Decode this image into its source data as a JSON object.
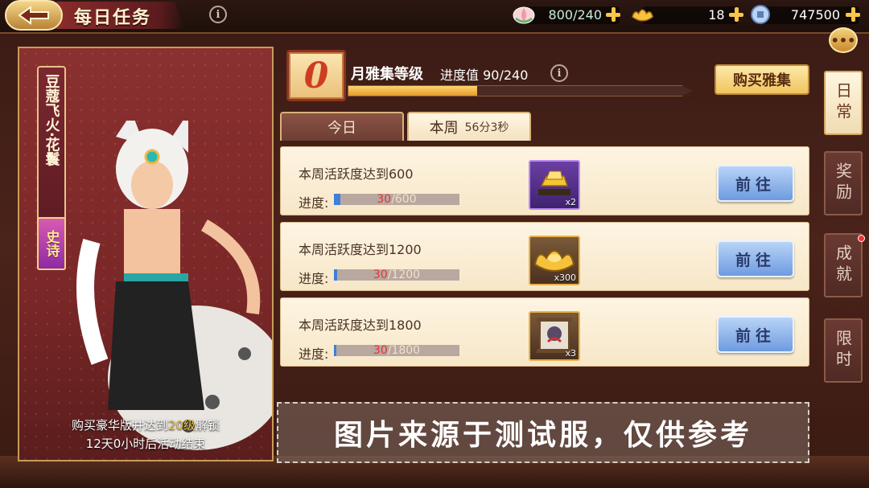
{
  "header": {
    "title": "每日任务",
    "info_icon": "i",
    "resources": [
      {
        "icon": "lotus-flower-icon",
        "value": "800/240"
      },
      {
        "icon": "gold-ingot-icon",
        "value": "18"
      },
      {
        "icon": "silver-coin-icon",
        "value": "747500"
      }
    ]
  },
  "left_panel": {
    "character_name": "豆蔻飞火·花鬟",
    "rarity": "史诗",
    "unlock_prefix": "购买豪华版并达到",
    "unlock_level": "20级",
    "unlock_suffix": "解锁",
    "countdown": "12天0小时后活动结束"
  },
  "level": {
    "value": "0",
    "label": "月雅集等级",
    "progress_label": "进度值 90/240",
    "progress_fraction": 0.375,
    "buy_button": "购买雅集"
  },
  "tabs": {
    "today": "今日",
    "week": "本周",
    "week_timer": "56分3秒"
  },
  "tasks": [
    {
      "name": "本周活跃度达到600",
      "progress_label": "进度:",
      "current": "30",
      "total": "/600",
      "fraction": 0.05,
      "reward_count": "x2",
      "reward_icon": "gold-bars-icon",
      "button": "前往"
    },
    {
      "name": "本周活跃度达到1200",
      "progress_label": "进度:",
      "current": "30",
      "total": "/1200",
      "fraction": 0.025,
      "reward_count": "x300",
      "reward_icon": "gold-ingot-icon",
      "button": "前往"
    },
    {
      "name": "本周活跃度达到1800",
      "progress_label": "进度:",
      "current": "30",
      "total": "/1800",
      "fraction": 0.017,
      "reward_count": "x3",
      "reward_icon": "portrait-scroll-icon",
      "button": "前往"
    }
  ],
  "watermark": "图片来源于测试服，仅供参考",
  "side_tabs": [
    "日常",
    "奖励",
    "成就",
    "限时"
  ],
  "colors": {
    "accent_gold": "#f0c560",
    "button_blue": "#6e9be0",
    "progress_red": "#e0363a"
  }
}
